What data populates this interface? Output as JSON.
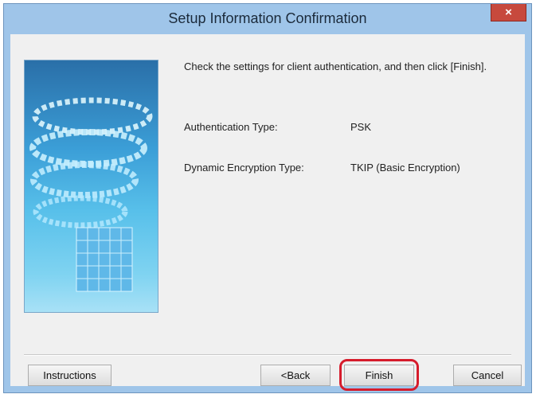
{
  "window": {
    "title": "Setup Information Confirmation",
    "close_glyph": "×"
  },
  "main": {
    "message": "Check the settings for client authentication, and then click [Finish].",
    "settings": [
      {
        "label": "Authentication Type:",
        "value": "PSK"
      },
      {
        "label": "Dynamic Encryption Type:",
        "value": "TKIP (Basic Encryption)"
      }
    ]
  },
  "buttons": {
    "instructions": "Instructions",
    "back": "<Back",
    "finish": "Finish",
    "cancel": "Cancel"
  },
  "colors": {
    "highlight": "#d61c2c",
    "titlebar": "#9fc5e9",
    "close": "#c7493d"
  },
  "illustration": "spiral-data-icon"
}
